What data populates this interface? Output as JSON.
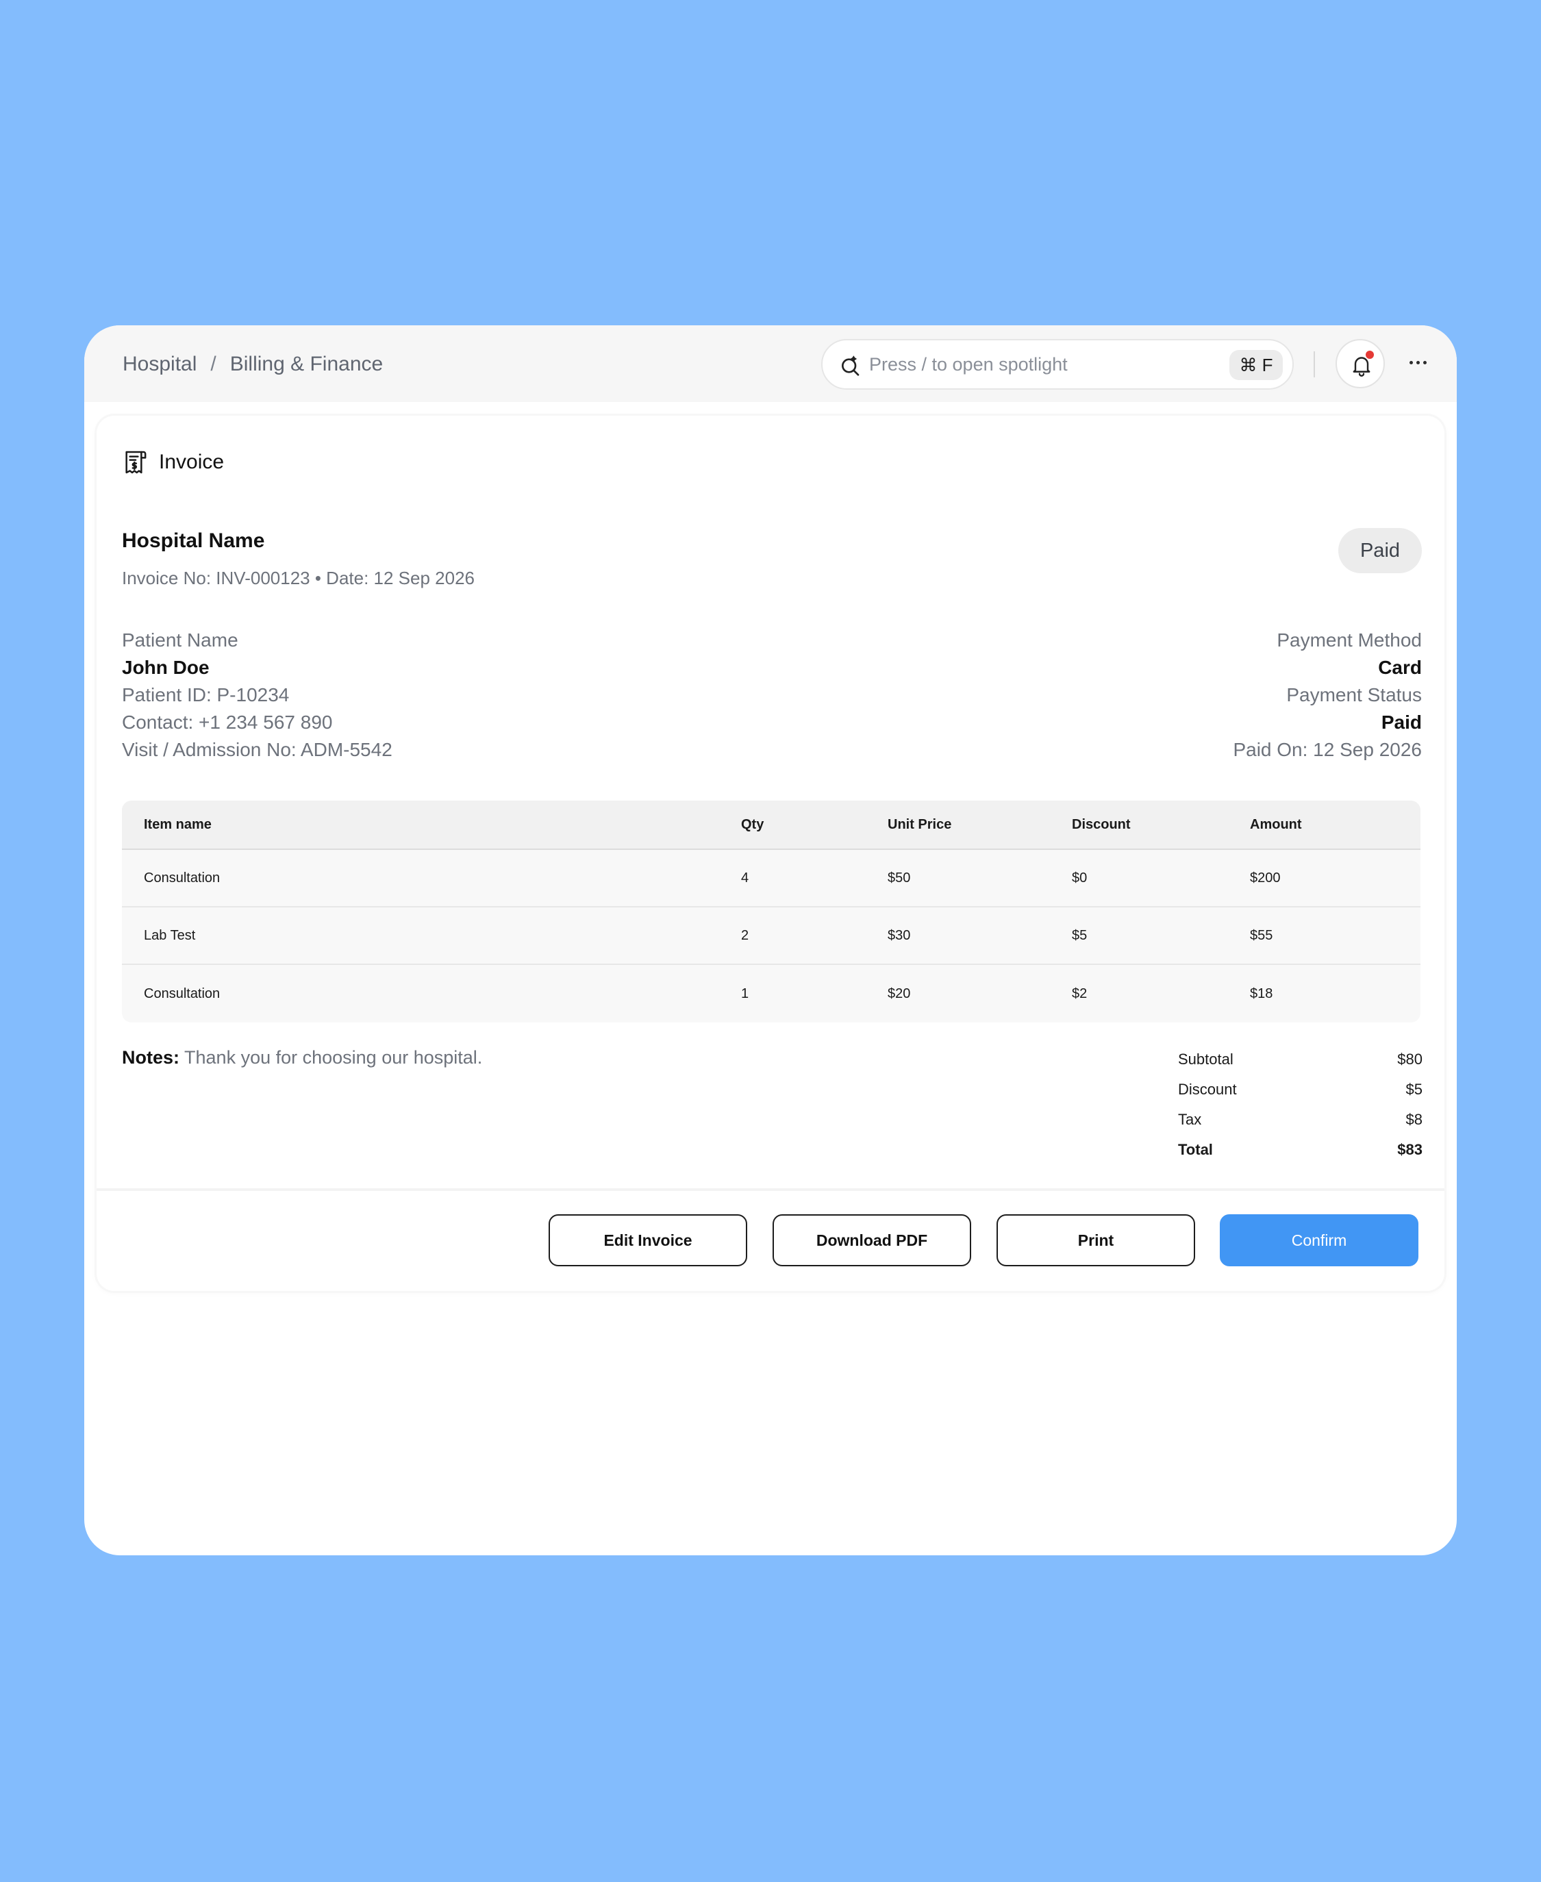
{
  "topbar": {
    "breadcrumb": [
      "Hospital",
      "Billing & Finance"
    ],
    "breadcrumb_separator": "/",
    "search_placeholder": "Press / to open spotlight",
    "search_shortcut": "⌘ F",
    "notification_indicator_color": "#e53935"
  },
  "invoice": {
    "title": "Invoice",
    "hospital_name": "Hospital Name",
    "meta": "Invoice No: INV-000123 • Date: 12 Sep 2026",
    "status": "Paid",
    "patient": {
      "label": "Patient Name",
      "name": "John Doe",
      "id": "Patient ID: P-10234",
      "contact": "Contact: +1 234 567 890",
      "visit": "Visit / Admission No: ADM-5542"
    },
    "payment": {
      "method_label": "Payment Method",
      "method": "Card",
      "status_label": "Payment Status",
      "status": "Paid",
      "paid_on": "Paid On: 12 Sep 2026"
    },
    "table": {
      "headers": [
        "Item name",
        "Qty",
        "Unit Price",
        "Discount",
        "Amount"
      ],
      "rows": [
        [
          "Consultation",
          "4",
          "$50",
          "$0",
          "$200"
        ],
        [
          "Lab Test",
          "2",
          "$30",
          "$5",
          "$55"
        ],
        [
          "Consultation",
          "1",
          "$20",
          "$2",
          "$18"
        ]
      ]
    },
    "notes_label": "Notes:",
    "notes_text": "Thank you for choosing our hospital.",
    "totals": [
      {
        "label": "Subtotal",
        "value": "$80"
      },
      {
        "label": "Discount",
        "value": "$5"
      },
      {
        "label": "Tax",
        "value": "$8"
      },
      {
        "label": "Total",
        "value": "$83"
      }
    ]
  },
  "actions": {
    "edit": "Edit Invoice",
    "download": "Download PDF",
    "print": "Print",
    "confirm": "Confirm",
    "confirm_color": "#4196f4"
  },
  "colors": {
    "background": "#83bcfd",
    "topbar": "#f6f6f6"
  }
}
